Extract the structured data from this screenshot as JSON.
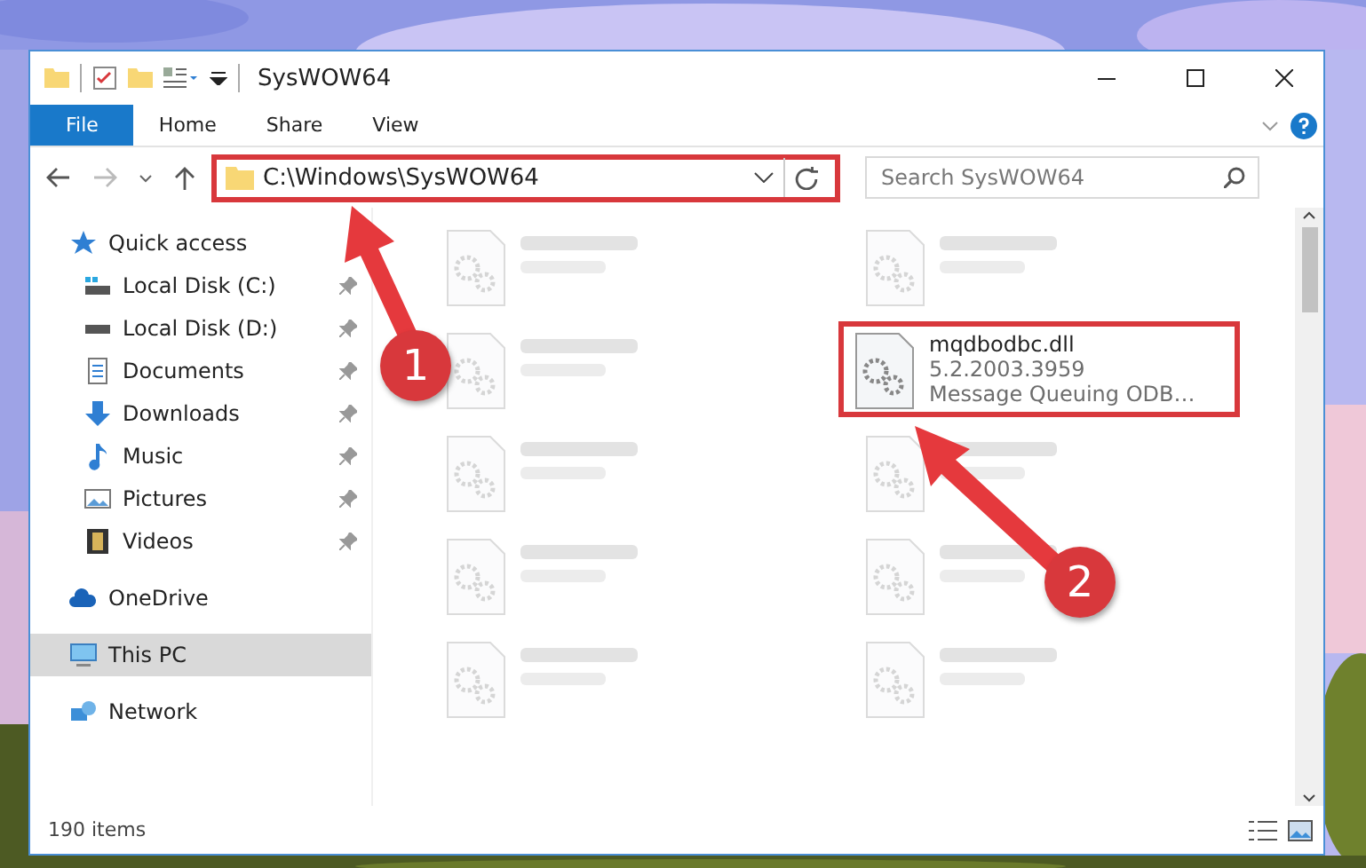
{
  "window": {
    "title": "SysWOW64"
  },
  "ribbon": {
    "tabs": [
      {
        "label": "File",
        "kind": "file"
      },
      {
        "label": "Home",
        "kind": "tab"
      },
      {
        "label": "Share",
        "kind": "tab"
      },
      {
        "label": "View",
        "kind": "tab"
      }
    ]
  },
  "address_bar": {
    "path": "C:\\Windows\\SysWOW64",
    "highlighted": true
  },
  "search": {
    "placeholder": "Search SysWOW64"
  },
  "sidebar": {
    "items": [
      {
        "label": "Quick access",
        "kind": "star",
        "selected": false,
        "children": [
          {
            "label": "Local Disk (C:)",
            "kind": "drive-c",
            "pinned": true,
            "selected": false
          },
          {
            "label": "Local Disk (D:)",
            "kind": "drive",
            "pinned": true,
            "selected": false
          },
          {
            "label": "Documents",
            "kind": "documents",
            "pinned": true,
            "selected": false
          },
          {
            "label": "Downloads",
            "kind": "downloads",
            "pinned": true,
            "selected": false
          },
          {
            "label": "Music",
            "kind": "music",
            "pinned": true,
            "selected": false
          },
          {
            "label": "Pictures",
            "kind": "pictures",
            "pinned": true,
            "selected": false
          },
          {
            "label": "Videos",
            "kind": "videos",
            "pinned": true,
            "selected": false
          }
        ]
      },
      {
        "label": "OneDrive",
        "kind": "cloud",
        "selected": false
      },
      {
        "label": "This PC",
        "kind": "pc",
        "selected": true
      },
      {
        "label": "Network",
        "kind": "network",
        "selected": false
      }
    ]
  },
  "files": [
    {
      "kind": "blurred",
      "highlighted": false
    },
    {
      "kind": "blurred",
      "highlighted": false
    },
    {
      "kind": "blurred",
      "highlighted": false
    },
    {
      "kind": "file",
      "name": "mqdbodbc.dll",
      "details": [
        "5.2.2003.3959",
        "Message Queuing ODB…"
      ],
      "highlighted": true
    },
    {
      "kind": "blurred",
      "highlighted": false
    },
    {
      "kind": "blurred",
      "highlighted": false
    },
    {
      "kind": "blurred",
      "highlighted": false
    },
    {
      "kind": "blurred",
      "highlighted": false
    },
    {
      "kind": "blurred",
      "highlighted": false
    },
    {
      "kind": "blurred",
      "highlighted": false
    }
  ],
  "status_bar": {
    "count": "190 items"
  },
  "annotations": [
    {
      "number": "1"
    },
    {
      "number": "2"
    }
  ]
}
